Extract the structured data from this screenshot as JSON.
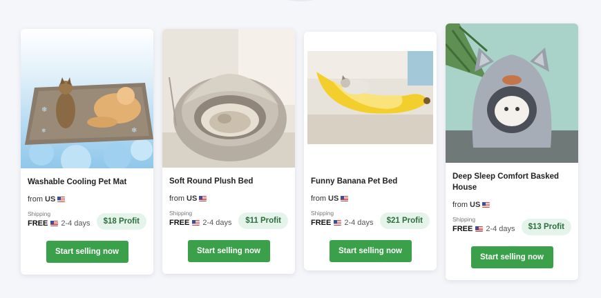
{
  "products": [
    {
      "title": "Washable Cooling Pet Mat",
      "from_label": "from",
      "origin": "US",
      "shipping_label": "Shipping",
      "shipping_price": "FREE",
      "shipping_time": "2-4 days",
      "profit": "$18 Profit",
      "cta": "Start selling now"
    },
    {
      "title": "Soft Round Plush Bed",
      "from_label": "from",
      "origin": "US",
      "shipping_label": "Shipping",
      "shipping_price": "FREE",
      "shipping_time": "2-4 days",
      "profit": "$11 Profit",
      "cta": "Start selling now"
    },
    {
      "title": "Funny Banana Pet Bed",
      "from_label": "from",
      "origin": "US",
      "shipping_label": "Shipping",
      "shipping_price": "FREE",
      "shipping_time": "2-4 days",
      "profit": "$21 Profit",
      "cta": "Start selling now"
    },
    {
      "title": "Deep Sleep Comfort Basked House",
      "from_label": "from",
      "origin": "US",
      "shipping_label": "Shipping",
      "shipping_price": "FREE",
      "shipping_time": "2-4 days",
      "profit": "$13 Profit",
      "cta": "Start selling now"
    }
  ],
  "colors": {
    "cta": "#3aa04a",
    "profit_bg": "#e5f4ea",
    "profit_text": "#2e6d3d"
  }
}
